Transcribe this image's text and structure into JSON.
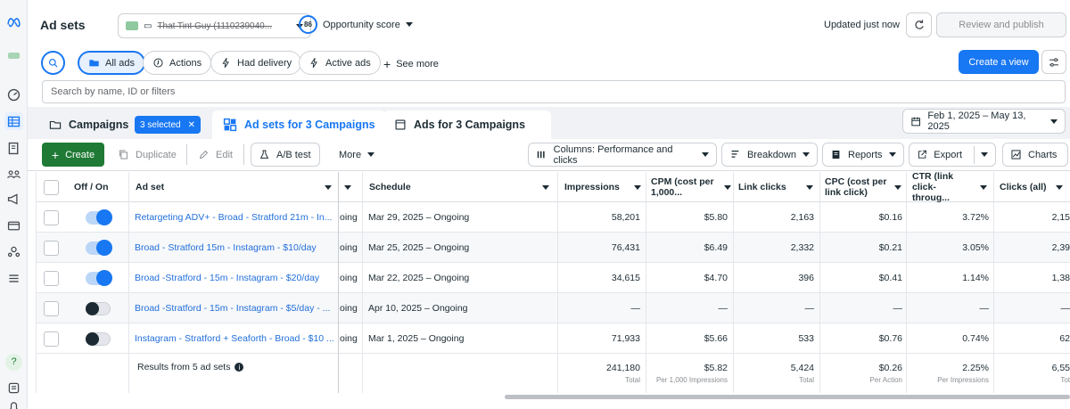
{
  "header": {
    "title": "Ad sets",
    "account_name": "That Tint Guy (1110239040...",
    "opportunity_score": "86",
    "opportunity_label": "Opportunity score",
    "updated": "Updated just now",
    "review_label": "Review and publish",
    "more_label": "..."
  },
  "filters": {
    "all_ads": "All ads",
    "actions": "Actions",
    "had_delivery": "Had delivery",
    "active_ads": "Active ads",
    "see_more": "See more",
    "create_view": "Create a view"
  },
  "search": {
    "placeholder": "Search by name, ID or filters"
  },
  "tabs": {
    "campaigns": "Campaigns",
    "selected_chip": "3 selected",
    "ad_sets": "Ad sets for 3 Campaigns",
    "ads": "Ads for 3 Campaigns",
    "date_range": "Feb 1, 2025 – May 13, 2025"
  },
  "toolbar": {
    "create": "Create",
    "duplicate": "Duplicate",
    "edit": "Edit",
    "ab_test": "A/B test",
    "more": "More",
    "columns": "Columns: Performance and clicks",
    "breakdown": "Breakdown",
    "reports": "Reports",
    "export": "Export",
    "charts": "Charts"
  },
  "table": {
    "headers": {
      "offon": "Off / On",
      "adset": "Ad set",
      "schedule": "Schedule",
      "impressions": "Impressions",
      "cpm": "CPM (cost per 1,000...",
      "link_clicks": "Link clicks",
      "cpc": "CPC (cost per link click)",
      "ctr": "CTR (link click-throug...",
      "clicks_all": "Clicks (all)"
    },
    "rows": [
      {
        "on": true,
        "name": "Retargeting ADV+ - Broad - Stratford 21m - In...",
        "status": "oing",
        "schedule": "Mar 29, 2025 – Ongoing",
        "impressions": "58,201",
        "cpm": "$5.80",
        "link_clicks": "2,163",
        "cpc": "$0.16",
        "ctr": "3.72%",
        "clicks_all": "2,15"
      },
      {
        "on": true,
        "name": "Broad - Stratford 15m - Instagram - $10/day",
        "status": "oing",
        "schedule": "Mar 25, 2025 – Ongoing",
        "impressions": "76,431",
        "cpm": "$6.49",
        "link_clicks": "2,332",
        "cpc": "$0.21",
        "ctr": "3.05%",
        "clicks_all": "2,39"
      },
      {
        "on": true,
        "name": "Broad -Stratford - 15m - Instagram - $20/day",
        "status": "oing",
        "schedule": "Mar 22, 2025 – Ongoing",
        "impressions": "34,615",
        "cpm": "$4.70",
        "link_clicks": "396",
        "cpc": "$0.41",
        "ctr": "1.14%",
        "clicks_all": "1,38"
      },
      {
        "on": false,
        "name": "Broad -Stratford - 15m - Instagram - $5/day - ...",
        "status": "oing",
        "schedule": "Apr 10, 2025 – Ongoing",
        "impressions": "—",
        "cpm": "—",
        "link_clicks": "—",
        "cpc": "—",
        "ctr": "—",
        "clicks_all": "—"
      },
      {
        "on": false,
        "name": "Instagram - Stratford + Seaforth - Broad - $10 ...",
        "status": "oing",
        "schedule": "Mar 1, 2025 – Ongoing",
        "impressions": "71,933",
        "cpm": "$5.66",
        "link_clicks": "533",
        "cpc": "$0.76",
        "ctr": "0.74%",
        "clicks_all": "62"
      }
    ],
    "summary": {
      "label": "Results from 5 ad sets",
      "impressions": "241,180",
      "impressions_sub": "Total",
      "cpm": "$5.82",
      "cpm_sub": "Per 1,000 Impressions",
      "link_clicks": "5,424",
      "link_clicks_sub": "Total",
      "cpc": "$0.26",
      "cpc_sub": "Per Action",
      "ctr": "2.25%",
      "ctr_sub": "Per Impressions",
      "clicks_all": "6,55",
      "clicks_all_sub": "Tot"
    }
  },
  "colors": {
    "accent": "#1877f2",
    "create_green": "#1f7a35",
    "link": "#216fdb"
  }
}
